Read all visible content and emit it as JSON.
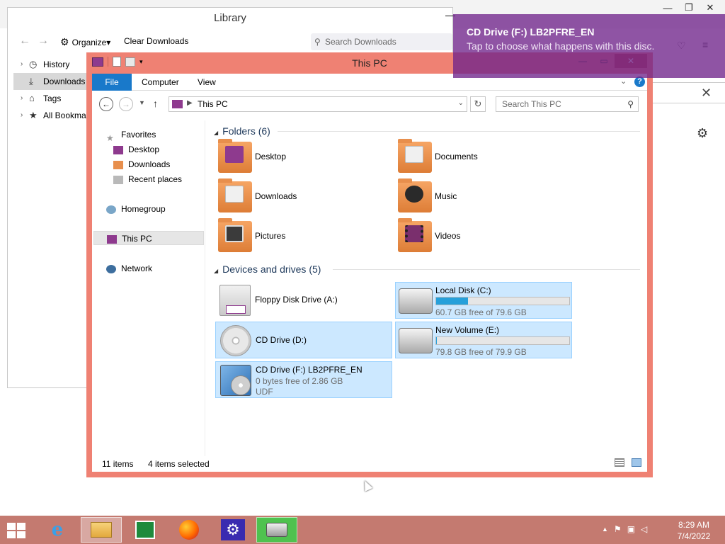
{
  "firefox": {
    "close_glyph": "✕",
    "restore_glyph": "❐",
    "min_glyph": "—",
    "gear_glyph": "⚙",
    "dismiss_glyph": "✕",
    "pocket_glyph": "♡",
    "menu_glyph": "≡"
  },
  "library": {
    "title": "Library",
    "min_glyph": "—",
    "back_glyph": "←",
    "forward_glyph": "→",
    "organize_label": "Organize",
    "organize_arrow": "▾",
    "clear_downloads_label": "Clear Downloads",
    "search_placeholder": "Search Downloads",
    "tree": [
      {
        "label": "History",
        "icon": "clock-icon",
        "glyph": "◷"
      },
      {
        "label": "Downloads",
        "icon": "download-icon",
        "glyph": "⤓"
      },
      {
        "label": "Tags",
        "icon": "tag-icon",
        "glyph": "⌂"
      },
      {
        "label": "All Bookmarks",
        "icon": "star-icon",
        "glyph": "★"
      }
    ]
  },
  "explorer": {
    "title": "This PC",
    "ribbon_tabs": {
      "file": "File",
      "computer": "Computer",
      "view": "View"
    },
    "help_glyph": "?",
    "address": "This PC",
    "search_placeholder": "Search This PC",
    "nav": {
      "favorites": "Favorites",
      "desktop": "Desktop",
      "downloads": "Downloads",
      "recent_places": "Recent places",
      "homegroup": "Homegroup",
      "this_pc": "This PC",
      "network": "Network"
    },
    "folders_header": "Folders (6)",
    "folders": [
      {
        "name": "Desktop",
        "color": "#8e3a8e"
      },
      {
        "name": "Documents",
        "color": "#f0f0f0"
      },
      {
        "name": "Downloads",
        "color": "#f0f0f0"
      },
      {
        "name": "Music",
        "color": "#2a2a2a"
      },
      {
        "name": "Pictures",
        "color": "#3b3b3b"
      },
      {
        "name": "Videos",
        "color": "#7a2f6d"
      }
    ],
    "devices_header": "Devices and drives (5)",
    "drives": {
      "floppy": {
        "name": "Floppy Disk Drive (A:)"
      },
      "local_c": {
        "name": "Local Disk (C:)",
        "free": "60.7 GB free of 79.6 GB",
        "used_fraction": 0.237
      },
      "cd_d": {
        "name": "CD Drive (D:)"
      },
      "new_e": {
        "name": "New Volume (E:)",
        "free": "79.8 GB free of 79.9 GB",
        "used_fraction": 0.002
      },
      "cd_f": {
        "name": "CD Drive (F:) LB2PFRE_EN",
        "line2": "0 bytes free of 2.86 GB",
        "line3": "UDF"
      }
    },
    "status": {
      "items": "11 items",
      "selected": "4 items selected"
    }
  },
  "toast": {
    "title": "CD Drive (F:) LB2PFRE_EN",
    "message": "Tap to choose what happens with this disc."
  },
  "taskbar": {
    "clock_time": "8:29 AM",
    "clock_date": "7/4/2022",
    "tray_up": "▲"
  }
}
